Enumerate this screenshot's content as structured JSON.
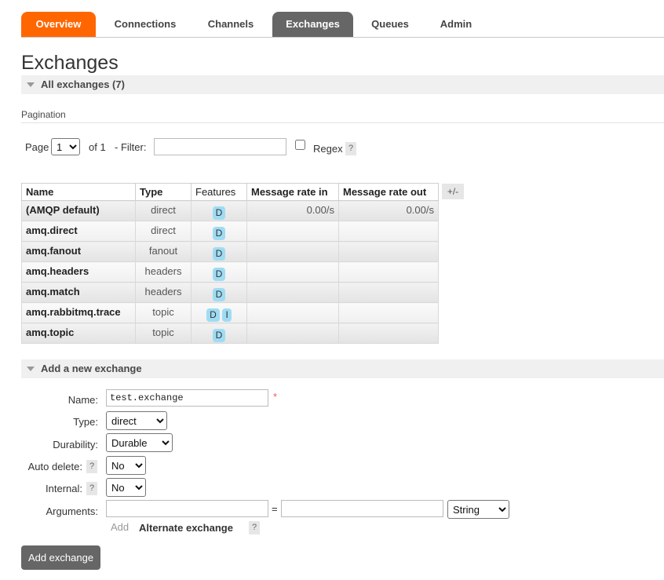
{
  "nav": {
    "tabs": [
      {
        "label": "Overview"
      },
      {
        "label": "Connections"
      },
      {
        "label": "Channels"
      },
      {
        "label": "Exchanges"
      },
      {
        "label": "Queues"
      },
      {
        "label": "Admin"
      }
    ],
    "selected": "Exchanges"
  },
  "page": {
    "title": "Exchanges",
    "all_section": "All exchanges (7)"
  },
  "pagination": {
    "heading": "Pagination",
    "page_label": "Page",
    "page_value": "1",
    "of_label": "of 1",
    "filter_label": "- Filter:",
    "filter_value": "",
    "regex_label": "Regex",
    "help": "?"
  },
  "table": {
    "headers": [
      "Name",
      "Type",
      "Features",
      "Message rate in",
      "Message rate out"
    ],
    "toggle": "+/-",
    "rows": [
      {
        "name": "(AMQP default)",
        "type": "direct",
        "features": [
          "D"
        ],
        "rate_in": "0.00/s",
        "rate_out": "0.00/s"
      },
      {
        "name": "amq.direct",
        "type": "direct",
        "features": [
          "D"
        ],
        "rate_in": "",
        "rate_out": ""
      },
      {
        "name": "amq.fanout",
        "type": "fanout",
        "features": [
          "D"
        ],
        "rate_in": "",
        "rate_out": ""
      },
      {
        "name": "amq.headers",
        "type": "headers",
        "features": [
          "D"
        ],
        "rate_in": "",
        "rate_out": ""
      },
      {
        "name": "amq.match",
        "type": "headers",
        "features": [
          "D"
        ],
        "rate_in": "",
        "rate_out": ""
      },
      {
        "name": "amq.rabbitmq.trace",
        "type": "topic",
        "features": [
          "D",
          "I"
        ],
        "rate_in": "",
        "rate_out": ""
      },
      {
        "name": "amq.topic",
        "type": "topic",
        "features": [
          "D"
        ],
        "rate_in": "",
        "rate_out": ""
      }
    ]
  },
  "add_form": {
    "section": "Add a new exchange",
    "name_label": "Name:",
    "name_value": "test.exchange",
    "required_mark": "*",
    "type_label": "Type:",
    "type_value": "direct",
    "durability_label": "Durability:",
    "durability_value": "Durable",
    "auto_delete_label": "Auto delete:",
    "auto_delete_value": "No",
    "internal_label": "Internal:",
    "internal_value": "No",
    "arguments_label": "Arguments:",
    "arg_key": "",
    "equals": "=",
    "arg_value": "",
    "arg_type_value": "String",
    "add_link": "Add",
    "alternate_exchange": "Alternate exchange",
    "help": "?",
    "submit_label": "Add exchange"
  },
  "colors": {
    "overview_tab": "#ff6600",
    "selected_tab": "#666666",
    "feature_badge": "#9fdcf3",
    "button": "#666666"
  }
}
